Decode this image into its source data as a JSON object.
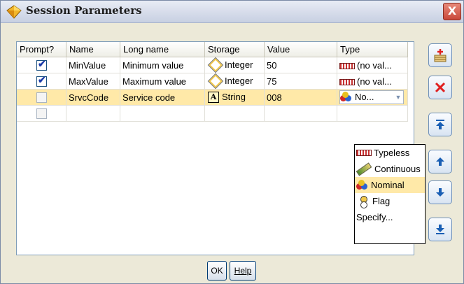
{
  "window": {
    "title": "Session Parameters",
    "close_glyph": "X"
  },
  "table": {
    "columns": [
      "Prompt?",
      "Name",
      "Long name",
      "Storage",
      "Value",
      "Type"
    ],
    "rows": [
      {
        "prompt": true,
        "name": "MinValue",
        "long_name": "Minimum value",
        "storage": "Integer",
        "storage_icon": "integer-diamond-icon",
        "value": "50",
        "type": "(no val...",
        "type_icon": "ruler-icon"
      },
      {
        "prompt": true,
        "name": "MaxValue",
        "long_name": "Maximum value",
        "storage": "Integer",
        "storage_icon": "integer-diamond-icon",
        "value": "75",
        "type": "(no val...",
        "type_icon": "ruler-icon"
      },
      {
        "prompt": false,
        "name": "SrvcCode",
        "long_name": "Service code",
        "storage": "String",
        "storage_icon": "string-a-icon",
        "value": "008",
        "type": "No...",
        "type_icon": "nominal-icon",
        "selected": true
      },
      {
        "prompt": false,
        "name": "",
        "long_name": "",
        "storage": "",
        "value": "",
        "type": ""
      }
    ]
  },
  "type_dropdown": {
    "items": [
      {
        "label": "Typeless",
        "icon": "ruler-icon"
      },
      {
        "label": "Continuous",
        "icon": "pencil-ruler-icon"
      },
      {
        "label": "Nominal",
        "icon": "nominal-icon",
        "active": true
      },
      {
        "label": "Flag",
        "icon": "flag-icon"
      },
      {
        "label": "Specify...",
        "icon": ""
      }
    ]
  },
  "side_buttons": [
    "add-parameter-icon",
    "delete-icon",
    "move-to-top-icon",
    "move-up-icon",
    "move-down-icon",
    "move-to-bottom-icon"
  ],
  "buttons": {
    "ok": "OK",
    "help": "Help"
  },
  "colors": {
    "selected_row": "#ffe9a8",
    "delete_red": "#e02020",
    "arrow_blue": "#1a5fb4"
  }
}
